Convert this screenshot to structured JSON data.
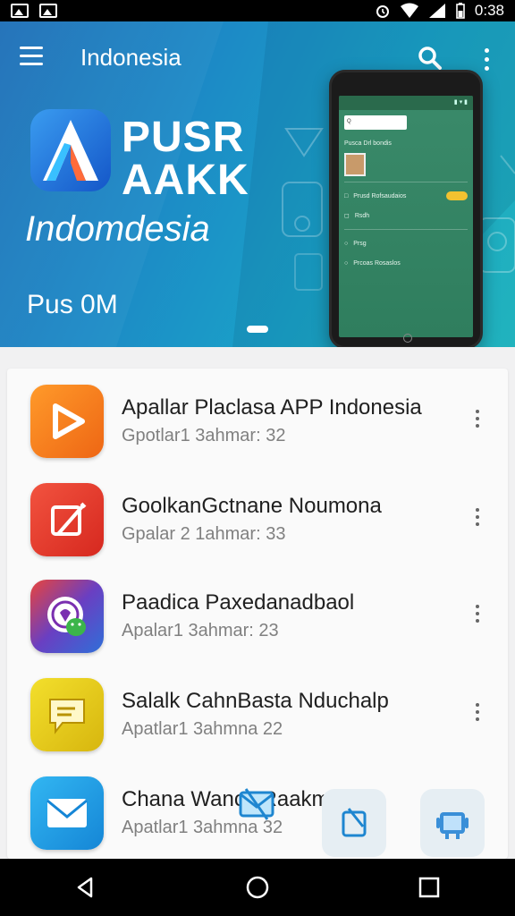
{
  "status_bar": {
    "time": "0:38"
  },
  "app_bar": {
    "title": "Indonesia"
  },
  "hero": {
    "brand_line1": "PUSR",
    "brand_line2": "AAKK",
    "brand_sub": "Indomdesia",
    "brand_tag": "Pus  0M"
  },
  "phone_mock": {
    "search_text": "Q",
    "profile_name": "Pusca Drl bondis",
    "row2": "Prusd Rofsaudaios",
    "row3": "Rsdh",
    "row4": "Prsg",
    "row5": "Prcoas Rosaslos"
  },
  "apps": [
    {
      "title": "Apallar Placlasa APP Indonesia",
      "subtitle": "Gpotlar1 3ahmar: 32",
      "icon": "play-icon",
      "color": "#f07a1a"
    },
    {
      "title": "GoolkanGctnane Noumona",
      "subtitle": "Gpalar 2 1ahmar: 33",
      "icon": "pen-icon",
      "color": "#e2392c"
    },
    {
      "title": "Paadica Paxedanadbaol",
      "subtitle": "Apalar1 3ahmar: 23",
      "icon": "android-icon",
      "color": "#3a52c4"
    },
    {
      "title": "Salalk CahnBasta Nduchalp",
      "subtitle": "Apatlar1 3ahmna 22",
      "icon": "message-icon",
      "color": "#e0c21a"
    },
    {
      "title": "Chana Wancx Raakma",
      "subtitle": "Apatlar1 3ahmna 32",
      "icon": "mail-icon",
      "color": "#1e9ee0"
    }
  ]
}
